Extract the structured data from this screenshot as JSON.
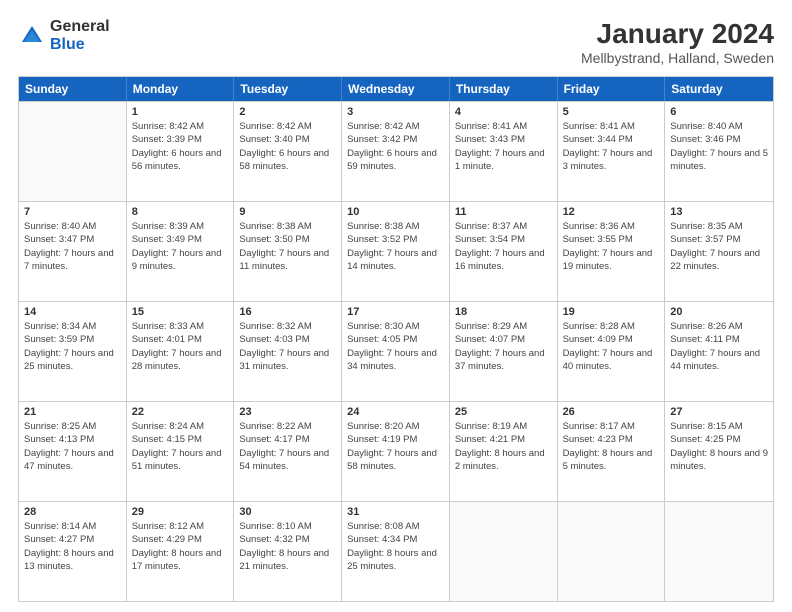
{
  "header": {
    "logo_general": "General",
    "logo_blue": "Blue",
    "main_title": "January 2024",
    "subtitle": "Mellbystrand, Halland, Sweden"
  },
  "calendar": {
    "days": [
      "Sunday",
      "Monday",
      "Tuesday",
      "Wednesday",
      "Thursday",
      "Friday",
      "Saturday"
    ],
    "weeks": [
      [
        {
          "day": "",
          "empty": true
        },
        {
          "day": "1",
          "sunrise": "Sunrise: 8:42 AM",
          "sunset": "Sunset: 3:39 PM",
          "daylight": "Daylight: 6 hours and 56 minutes."
        },
        {
          "day": "2",
          "sunrise": "Sunrise: 8:42 AM",
          "sunset": "Sunset: 3:40 PM",
          "daylight": "Daylight: 6 hours and 58 minutes."
        },
        {
          "day": "3",
          "sunrise": "Sunrise: 8:42 AM",
          "sunset": "Sunset: 3:42 PM",
          "daylight": "Daylight: 6 hours and 59 minutes."
        },
        {
          "day": "4",
          "sunrise": "Sunrise: 8:41 AM",
          "sunset": "Sunset: 3:43 PM",
          "daylight": "Daylight: 7 hours and 1 minute."
        },
        {
          "day": "5",
          "sunrise": "Sunrise: 8:41 AM",
          "sunset": "Sunset: 3:44 PM",
          "daylight": "Daylight: 7 hours and 3 minutes."
        },
        {
          "day": "6",
          "sunrise": "Sunrise: 8:40 AM",
          "sunset": "Sunset: 3:46 PM",
          "daylight": "Daylight: 7 hours and 5 minutes."
        }
      ],
      [
        {
          "day": "7",
          "sunrise": "Sunrise: 8:40 AM",
          "sunset": "Sunset: 3:47 PM",
          "daylight": "Daylight: 7 hours and 7 minutes."
        },
        {
          "day": "8",
          "sunrise": "Sunrise: 8:39 AM",
          "sunset": "Sunset: 3:49 PM",
          "daylight": "Daylight: 7 hours and 9 minutes."
        },
        {
          "day": "9",
          "sunrise": "Sunrise: 8:38 AM",
          "sunset": "Sunset: 3:50 PM",
          "daylight": "Daylight: 7 hours and 11 minutes."
        },
        {
          "day": "10",
          "sunrise": "Sunrise: 8:38 AM",
          "sunset": "Sunset: 3:52 PM",
          "daylight": "Daylight: 7 hours and 14 minutes."
        },
        {
          "day": "11",
          "sunrise": "Sunrise: 8:37 AM",
          "sunset": "Sunset: 3:54 PM",
          "daylight": "Daylight: 7 hours and 16 minutes."
        },
        {
          "day": "12",
          "sunrise": "Sunrise: 8:36 AM",
          "sunset": "Sunset: 3:55 PM",
          "daylight": "Daylight: 7 hours and 19 minutes."
        },
        {
          "day": "13",
          "sunrise": "Sunrise: 8:35 AM",
          "sunset": "Sunset: 3:57 PM",
          "daylight": "Daylight: 7 hours and 22 minutes."
        }
      ],
      [
        {
          "day": "14",
          "sunrise": "Sunrise: 8:34 AM",
          "sunset": "Sunset: 3:59 PM",
          "daylight": "Daylight: 7 hours and 25 minutes."
        },
        {
          "day": "15",
          "sunrise": "Sunrise: 8:33 AM",
          "sunset": "Sunset: 4:01 PM",
          "daylight": "Daylight: 7 hours and 28 minutes."
        },
        {
          "day": "16",
          "sunrise": "Sunrise: 8:32 AM",
          "sunset": "Sunset: 4:03 PM",
          "daylight": "Daylight: 7 hours and 31 minutes."
        },
        {
          "day": "17",
          "sunrise": "Sunrise: 8:30 AM",
          "sunset": "Sunset: 4:05 PM",
          "daylight": "Daylight: 7 hours and 34 minutes."
        },
        {
          "day": "18",
          "sunrise": "Sunrise: 8:29 AM",
          "sunset": "Sunset: 4:07 PM",
          "daylight": "Daylight: 7 hours and 37 minutes."
        },
        {
          "day": "19",
          "sunrise": "Sunrise: 8:28 AM",
          "sunset": "Sunset: 4:09 PM",
          "daylight": "Daylight: 7 hours and 40 minutes."
        },
        {
          "day": "20",
          "sunrise": "Sunrise: 8:26 AM",
          "sunset": "Sunset: 4:11 PM",
          "daylight": "Daylight: 7 hours and 44 minutes."
        }
      ],
      [
        {
          "day": "21",
          "sunrise": "Sunrise: 8:25 AM",
          "sunset": "Sunset: 4:13 PM",
          "daylight": "Daylight: 7 hours and 47 minutes."
        },
        {
          "day": "22",
          "sunrise": "Sunrise: 8:24 AM",
          "sunset": "Sunset: 4:15 PM",
          "daylight": "Daylight: 7 hours and 51 minutes."
        },
        {
          "day": "23",
          "sunrise": "Sunrise: 8:22 AM",
          "sunset": "Sunset: 4:17 PM",
          "daylight": "Daylight: 7 hours and 54 minutes."
        },
        {
          "day": "24",
          "sunrise": "Sunrise: 8:20 AM",
          "sunset": "Sunset: 4:19 PM",
          "daylight": "Daylight: 7 hours and 58 minutes."
        },
        {
          "day": "25",
          "sunrise": "Sunrise: 8:19 AM",
          "sunset": "Sunset: 4:21 PM",
          "daylight": "Daylight: 8 hours and 2 minutes."
        },
        {
          "day": "26",
          "sunrise": "Sunrise: 8:17 AM",
          "sunset": "Sunset: 4:23 PM",
          "daylight": "Daylight: 8 hours and 5 minutes."
        },
        {
          "day": "27",
          "sunrise": "Sunrise: 8:15 AM",
          "sunset": "Sunset: 4:25 PM",
          "daylight": "Daylight: 8 hours and 9 minutes."
        }
      ],
      [
        {
          "day": "28",
          "sunrise": "Sunrise: 8:14 AM",
          "sunset": "Sunset: 4:27 PM",
          "daylight": "Daylight: 8 hours and 13 minutes."
        },
        {
          "day": "29",
          "sunrise": "Sunrise: 8:12 AM",
          "sunset": "Sunset: 4:29 PM",
          "daylight": "Daylight: 8 hours and 17 minutes."
        },
        {
          "day": "30",
          "sunrise": "Sunrise: 8:10 AM",
          "sunset": "Sunset: 4:32 PM",
          "daylight": "Daylight: 8 hours and 21 minutes."
        },
        {
          "day": "31",
          "sunrise": "Sunrise: 8:08 AM",
          "sunset": "Sunset: 4:34 PM",
          "daylight": "Daylight: 8 hours and 25 minutes."
        },
        {
          "day": "",
          "empty": true
        },
        {
          "day": "",
          "empty": true
        },
        {
          "day": "",
          "empty": true
        }
      ]
    ]
  }
}
